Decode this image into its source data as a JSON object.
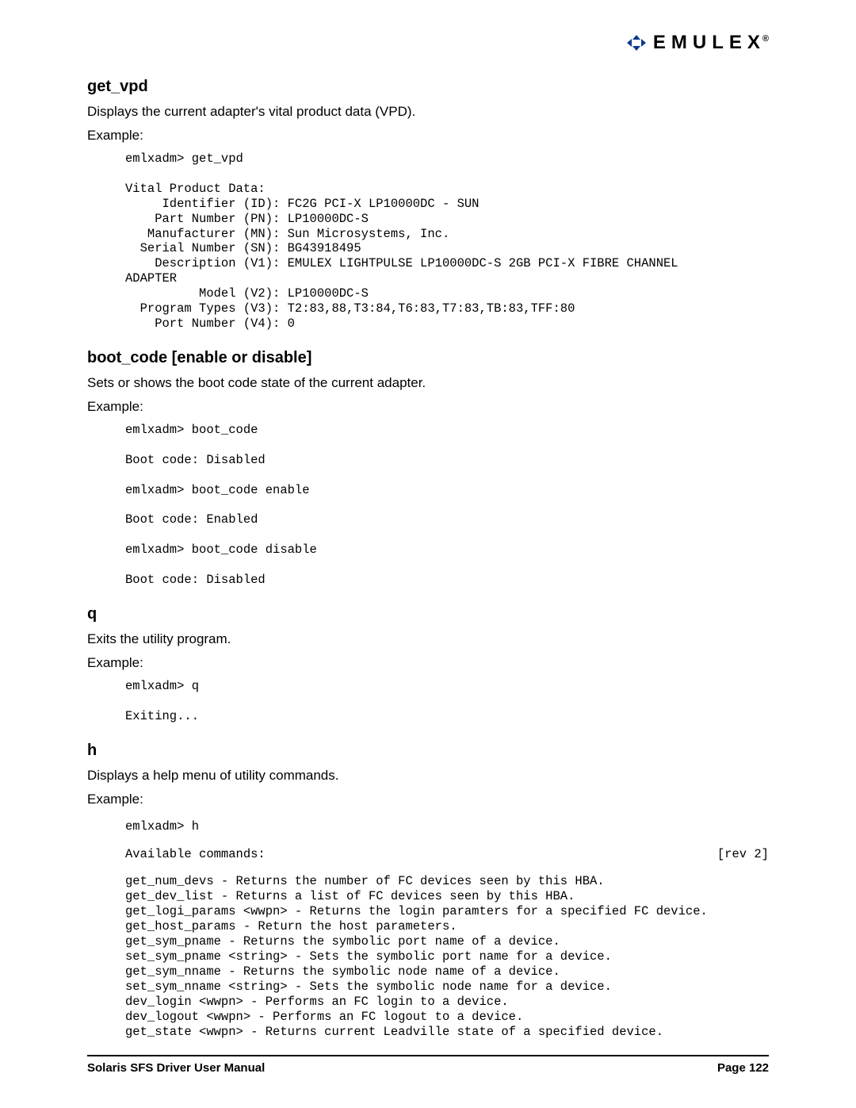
{
  "logo": {
    "word": "EMULEX",
    "reg": "®"
  },
  "sections": {
    "get_vpd": {
      "title": "get_vpd",
      "desc": "Displays the current adapter's vital product data (VPD).",
      "example_label": "Example:",
      "code": "emlxadm> get_vpd\n\nVital Product Data:\n     Identifier (ID): FC2G PCI-X LP10000DC - SUN\n    Part Number (PN): LP10000DC-S\n   Manufacturer (MN): Sun Microsystems, Inc.\n  Serial Number (SN): BG43918495\n    Description (V1): EMULEX LIGHTPULSE LP10000DC-S 2GB PCI-X FIBRE CHANNEL \nADAPTER\n          Model (V2): LP10000DC-S\n  Program Types (V3): T2:83,88,T3:84,T6:83,T7:83,TB:83,TFF:80\n    Port Number (V4): 0"
    },
    "boot_code": {
      "title": "boot_code [enable or disable]",
      "desc": "Sets or shows the boot code state of the current adapter.",
      "example_label": "Example:",
      "code": "emlxadm> boot_code\n\nBoot code: Disabled\n\nemlxadm> boot_code enable\n\nBoot code: Enabled\n\nemlxadm> boot_code disable\n\nBoot code: Disabled"
    },
    "q": {
      "title": "q",
      "desc": "Exits the utility program.",
      "example_label": "Example:",
      "code": "emlxadm> q\n\nExiting..."
    },
    "h": {
      "title": "h",
      "desc": "Displays a help menu of utility commands.",
      "example_label": "Example:",
      "cmd": "emlxadm> h",
      "avail_left": "Available commands:",
      "avail_right": "[rev 2]",
      "list": "get_num_devs - Returns the number of FC devices seen by this HBA.\nget_dev_list - Returns a list of FC devices seen by this HBA.\nget_logi_params <wwpn> - Returns the login paramters for a specified FC device.\nget_host_params - Return the host parameters.\nget_sym_pname - Returns the symbolic port name of a device.\nset_sym_pname <string> - Sets the symbolic port name for a device.\nget_sym_nname - Returns the symbolic node name of a device.\nset_sym_nname <string> - Sets the symbolic node name for a device.\ndev_login <wwpn> - Performs an FC login to a device.\ndev_logout <wwpn> - Performs an FC logout to a device.\nget_state <wwpn> - Returns current Leadville state of a specified device."
    }
  },
  "footer": {
    "left": "Solaris SFS Driver User Manual",
    "right": "Page 122"
  }
}
